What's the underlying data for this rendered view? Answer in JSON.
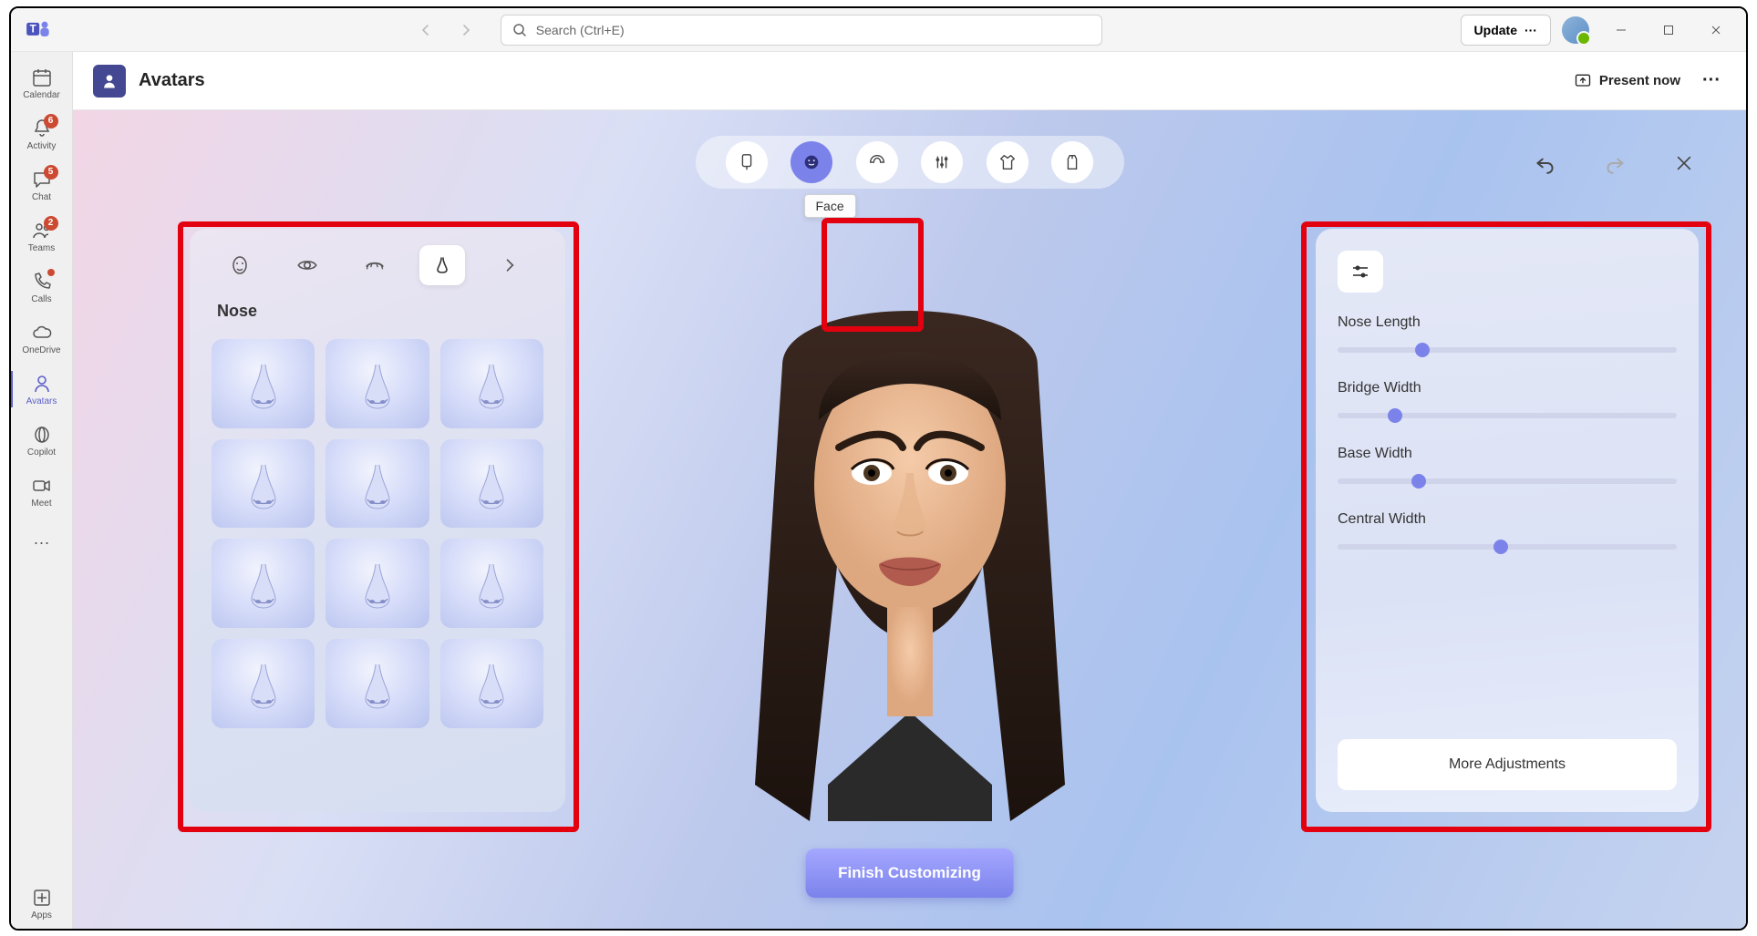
{
  "titlebar": {
    "search_placeholder": "Search (Ctrl+E)",
    "update_label": "Update"
  },
  "sidebar": {
    "items": [
      {
        "label": "Calendar",
        "icon": "calendar-icon",
        "badge": null
      },
      {
        "label": "Activity",
        "icon": "bell-icon",
        "badge": "6"
      },
      {
        "label": "Chat",
        "icon": "chat-icon",
        "badge": "5"
      },
      {
        "label": "Teams",
        "icon": "people-icon",
        "badge": "2"
      },
      {
        "label": "Calls",
        "icon": "phone-icon",
        "dot": true
      },
      {
        "label": "OneDrive",
        "icon": "cloud-icon"
      },
      {
        "label": "Avatars",
        "icon": "avatar-icon",
        "active": true
      },
      {
        "label": "Copilot",
        "icon": "copilot-icon"
      },
      {
        "label": "Meet",
        "icon": "video-icon"
      }
    ],
    "more_label": "",
    "apps_label": "Apps"
  },
  "header": {
    "title": "Avatars",
    "present_label": "Present now"
  },
  "categories": {
    "items": [
      {
        "name": "body-icon"
      },
      {
        "name": "face-icon",
        "selected": true
      },
      {
        "name": "hair-icon"
      },
      {
        "name": "appearance-icon"
      },
      {
        "name": "clothing-icon"
      },
      {
        "name": "wardrobe-icon"
      }
    ],
    "tooltip": "Face"
  },
  "left_panel": {
    "tabs": [
      {
        "name": "face-shape-icon"
      },
      {
        "name": "eyes-icon"
      },
      {
        "name": "eyebrows-icon"
      },
      {
        "name": "nose-icon",
        "selected": true
      },
      {
        "name": "next-icon"
      }
    ],
    "title": "Nose",
    "option_count": 12
  },
  "right_panel": {
    "sliders": [
      {
        "label": "Nose Length",
        "value": 25
      },
      {
        "label": "Bridge Width",
        "value": 17
      },
      {
        "label": "Base Width",
        "value": 24
      },
      {
        "label": "Central Width",
        "value": 48
      }
    ],
    "more_label": "More Adjustments"
  },
  "finish_label": "Finish Customizing"
}
